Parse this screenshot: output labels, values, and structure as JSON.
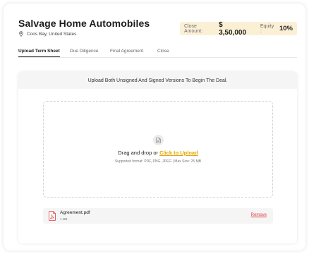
{
  "header": {
    "title": "Salvage Home Automobiles",
    "location": "Coos Bay, United States",
    "close_amount_label": "Close Amount:",
    "close_amount_value": "$ 3,50,000",
    "equity_label": "Equity :",
    "equity_value": "10%"
  },
  "tabs": [
    {
      "label": "Upload Term Sheet",
      "active": true
    },
    {
      "label": "Due Diligence",
      "active": false
    },
    {
      "label": "Final Agreement",
      "active": false
    },
    {
      "label": "Close",
      "active": false
    }
  ],
  "panel": {
    "heading": "Upload Both Unsigned And Signed Versions To Begin The Deal."
  },
  "dropzone": {
    "prompt": "Drag and drop or ",
    "link": "Click to Upload",
    "support": "Supported format: PDF, PNG, JPEG  |  Max Size: 25 MB"
  },
  "file": {
    "name": "Agreement.pdf",
    "size": "1 MB",
    "remove_label": "Remove"
  },
  "colors": {
    "accent": "#e0a500",
    "deal_box_bg": "#fbf0d6",
    "remove": "#e03b3b"
  },
  "icons": [
    "location-pin-icon",
    "file-icon",
    "pdf-file-icon"
  ]
}
